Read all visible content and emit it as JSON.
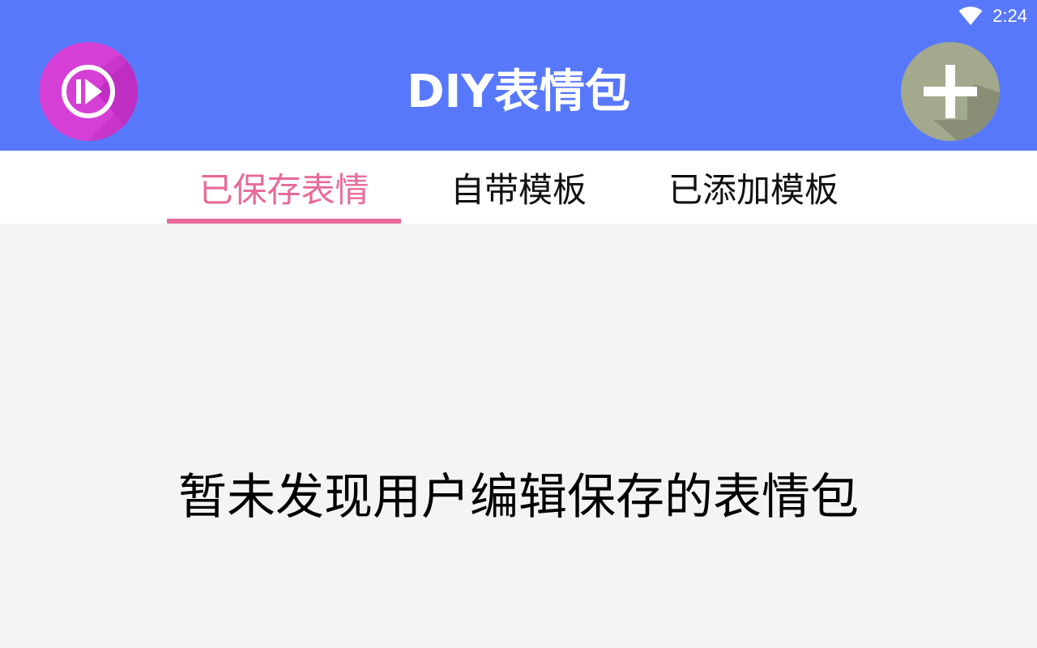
{
  "status_bar": {
    "time": "2:24",
    "wifi_icon": "wifi-icon"
  },
  "header": {
    "title": "DIY表情包",
    "left_icon": "play-circle-icon",
    "right_icon": "plus-icon",
    "background_color": "#5878fc",
    "left_button_color": "#d63fd6",
    "right_button_color": "#a3a98d"
  },
  "tabs": [
    {
      "label": "已保存表情",
      "active": true
    },
    {
      "label": "自带模板",
      "active": false
    },
    {
      "label": "已添加模板",
      "active": false
    }
  ],
  "accent_color": "#e86a98",
  "main": {
    "empty_message": "暂未发现用户编辑保存的表情包"
  }
}
